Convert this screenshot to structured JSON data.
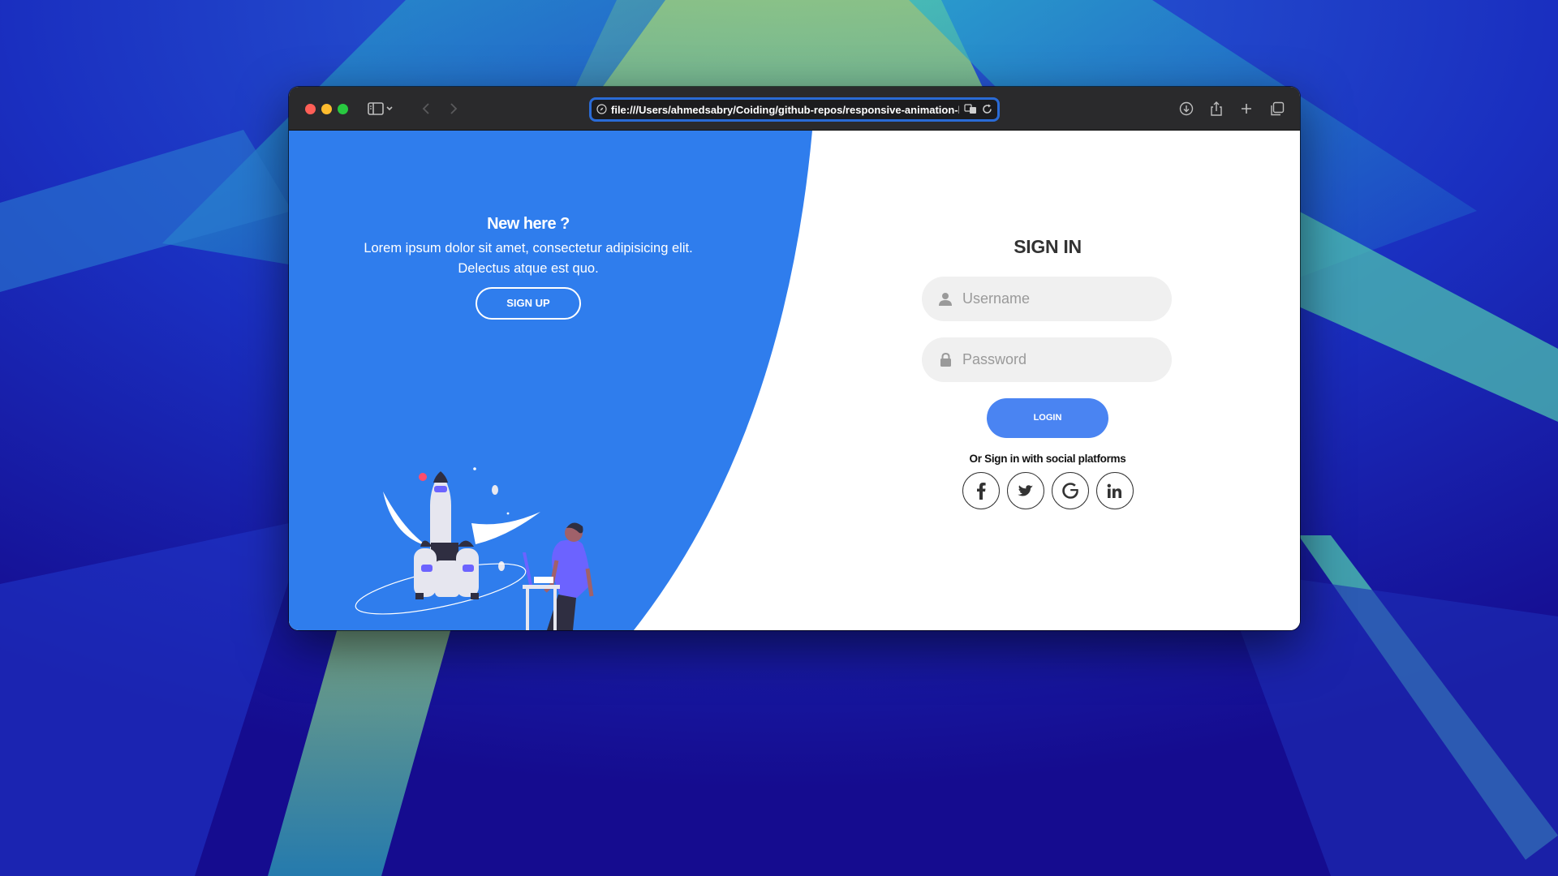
{
  "browser": {
    "url": "file:///Users/ahmedsabry/Coiding/github-repos/responsive-animation-login-and-register-page/index.html"
  },
  "panel": {
    "title": "New here ?",
    "text_line1": "Lorem ipsum dolor sit amet, consectetur adipisicing elit.",
    "text_line2": "Delectus atque est quo.",
    "signup_label": "SIGN UP",
    "accent_color": "#2f7ded"
  },
  "signin": {
    "title": "SIGN IN",
    "username_placeholder": "Username",
    "password_placeholder": "Password",
    "login_label": "LOGIN",
    "social_text": "Or Sign in with social platforms",
    "button_color": "#4a84f2",
    "socials": [
      "facebook-icon",
      "twitter-icon",
      "google-icon",
      "linkedin-icon"
    ]
  }
}
